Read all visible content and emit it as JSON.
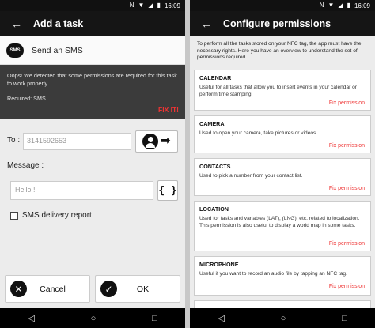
{
  "status": {
    "time": "16:09"
  },
  "left": {
    "appbar_title": "Add a task",
    "task": {
      "badge": "SMS",
      "name": "Send an SMS"
    },
    "warning": {
      "text": "Oops! We detected that some permissions are required for this task to work properly.",
      "required": "Required: SMS",
      "fix": "FIX IT!"
    },
    "to_label": "To :",
    "to_value": "3141592653",
    "message_label": "Message :",
    "message_value": "Hello !",
    "brace_label": "{ }",
    "delivery_report_label": "SMS delivery report",
    "cancel_label": "Cancel",
    "ok_label": "OK"
  },
  "right": {
    "appbar_title": "Configure permissions",
    "intro": "To perform all the tasks stored on your NFC tag, the app must have the necessary rights. Here you have an overview to understand the set of permissions required.",
    "fix_label": "Fix permission",
    "permissions": [
      {
        "title": "CALENDAR",
        "desc": "Useful for all tasks that allow you to insert events in your calendar or perform time stamping."
      },
      {
        "title": "CAMERA",
        "desc": "Used to open your camera, take pictures or videos."
      },
      {
        "title": "CONTACTS",
        "desc": "Used to pick a number from your contact list."
      },
      {
        "title": "LOCATION",
        "desc": "Used for tasks and variables (LAT), (LNG), etc. related to localization. This permission is also useful to display a world map in some tasks."
      },
      {
        "title": "MICROPHONE",
        "desc": "Useful if you want to record an audio file by tapping an NFC tag."
      }
    ]
  },
  "icons": {
    "back": "arrow-left-icon",
    "sms": "sms-bubble-icon",
    "contact": "person-arrow-icon",
    "cancel": "close-circle-icon",
    "ok": "check-circle-icon",
    "nav_back": "triangle-back-icon",
    "nav_home": "circle-home-icon",
    "nav_recent": "square-recent-icon"
  }
}
